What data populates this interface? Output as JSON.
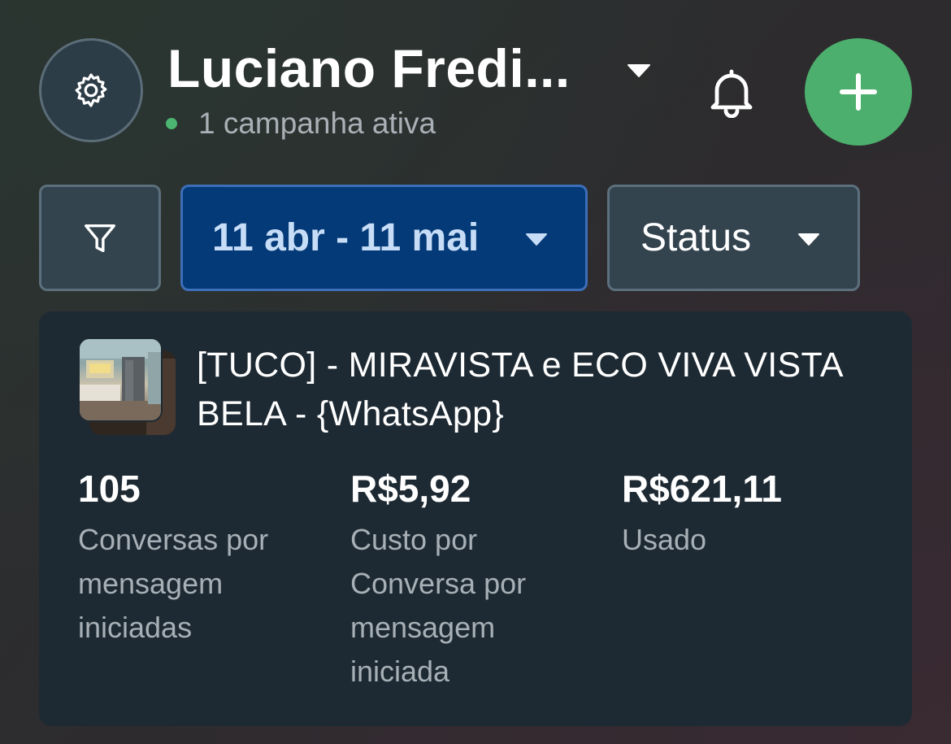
{
  "header": {
    "account_name": "Luciano Fredi...",
    "active_campaigns": "1 campanha ativa",
    "status_color": "#4bb571",
    "add_button_color": "#4caf6d",
    "icons": {
      "settings": "gear-icon",
      "dropdown": "caret-down-icon",
      "notifications": "bell-icon",
      "add": "plus-icon"
    }
  },
  "filters": {
    "filter_icon": "funnel-icon",
    "date_range": "11 abr - 11 mai",
    "status_label": "Status",
    "date_accent_color": "#043a78"
  },
  "campaign": {
    "title": "[TUCO] - MIRAVISTA e ECO VIVA VISTA BELA - {WhatsApp}",
    "metrics": [
      {
        "value": "105",
        "label": "Conversas por mensagem iniciadas"
      },
      {
        "value": "R$5,92",
        "label": "Custo por Conversa por mensagem iniciada"
      },
      {
        "value": "R$621,11",
        "label": "Usado"
      }
    ]
  }
}
